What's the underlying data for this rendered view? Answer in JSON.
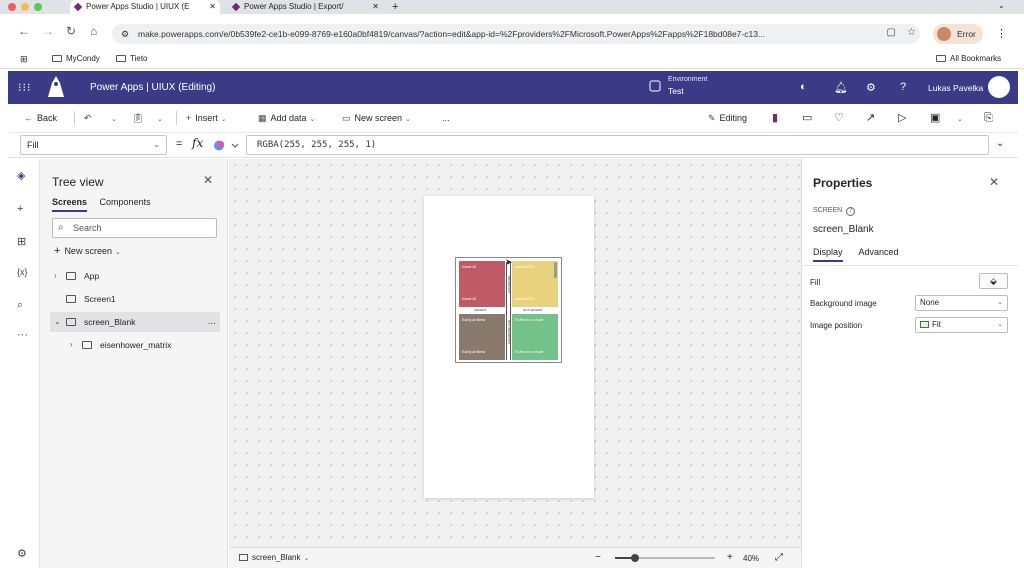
{
  "browser": {
    "tabs": [
      {
        "title": "Power Apps Studio | UIUX (E"
      },
      {
        "title": "Power Apps Studio | Export/"
      }
    ],
    "new_tab": "+",
    "url": "make.powerapps.com/e/0b539fe2-ce1b-e099-8769-e160a0bf4819/canvas/?action=edit&app-id=%2Fproviders%2FMicrosoft.PowerApps%2Fapps%2F18bd08e7-c13...",
    "profile_status": "Error",
    "bookmarks": [
      "MyCondy",
      "Tieto"
    ],
    "all_bookmarks": "All Bookmarks"
  },
  "app": {
    "title": "Power Apps  |  UIUX (Editing)",
    "environment_label": "Environment",
    "environment_value": "Test",
    "user_name": "Lukas Pavelka"
  },
  "commands": {
    "back": "Back",
    "insert": "Insert",
    "add_data": "Add data",
    "new_screen": "New screen",
    "more": "...",
    "editing": "Editing"
  },
  "formula": {
    "property": "Fill",
    "equals": "=",
    "fx": "fx",
    "value": "RGBA(255, 255, 255, 1)"
  },
  "tree": {
    "title": "Tree view",
    "tabs": [
      "Screens",
      "Components"
    ],
    "search_placeholder": "Search",
    "new_screen": "New screen",
    "nodes": [
      "App",
      "Screen1",
      "screen_Blank",
      "eisenhower_matrix"
    ],
    "more": "..."
  },
  "matrix": {
    "quadrants": [
      {
        "top": "Invest 45",
        "bottom": "Invest 45",
        "color": "#c05a65"
      },
      {
        "top": "Invest 10 %",
        "bottom": "Invest 10 %",
        "color": "#e9d27e"
      },
      {
        "top": "Easily all items",
        "bottom": "Easily all items",
        "color": "#8a7a6e"
      },
      {
        "top": "To find in a minute",
        "bottom": "To find in a minute",
        "color": "#74c18a"
      }
    ],
    "urgent": "URGENT",
    "not_urgent": "NOT URGENT",
    "important": "IMPORTANT",
    "not_important": "NOT IMPORTANT"
  },
  "statusbar": {
    "screen": "screen_Blank",
    "zoom_pct": "40%",
    "zoom_level": 0.2
  },
  "properties": {
    "title": "Properties",
    "kind": "SCREEN",
    "name": "screen_Blank",
    "tabs": [
      "Display",
      "Advanced"
    ],
    "fill_label": "Fill",
    "bg_image_label": "Background image",
    "bg_image_value": "None",
    "img_pos_label": "Image position",
    "img_pos_value": "Fit"
  },
  "colors": {
    "header": "#3b3a87",
    "accent": "#742774"
  }
}
